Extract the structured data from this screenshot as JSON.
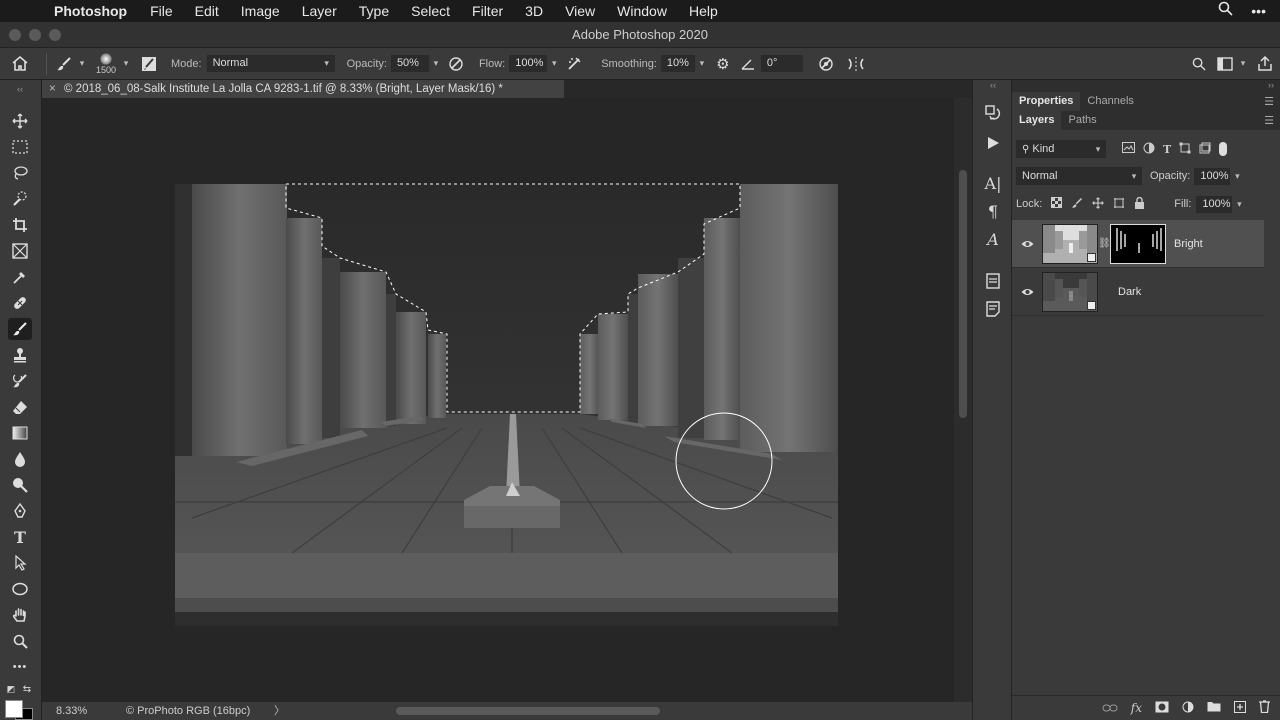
{
  "menubar": {
    "app_name": "Photoshop",
    "items": [
      "File",
      "Edit",
      "Image",
      "Layer",
      "Type",
      "Select",
      "Filter",
      "3D",
      "View",
      "Window",
      "Help"
    ],
    "right_icons": [
      "search-icon",
      "more-icon"
    ]
  },
  "titlebar": {
    "title": "Adobe Photoshop 2020"
  },
  "options": {
    "brush_size": "1500",
    "mode_label": "Mode:",
    "mode_value": "Normal",
    "opacity_label": "Opacity:",
    "opacity_value": "50%",
    "flow_label": "Flow:",
    "flow_value": "100%",
    "smoothing_label": "Smoothing:",
    "smoothing_value": "10%",
    "angle_value": "0°"
  },
  "document": {
    "tab_title": "© 2018_06_08-Salk Institute La Jolla CA 9283-1.tif @ 8.33% (Bright, Layer Mask/16) *",
    "close_label": "×"
  },
  "statusbar": {
    "zoom": "8.33%",
    "profile": "© ProPhoto RGB (16bpc)",
    "arrow": "〉"
  },
  "panels": {
    "top_tabs": [
      {
        "label": "Properties",
        "active": true
      },
      {
        "label": "Channels",
        "active": false
      }
    ],
    "layer_tabs": [
      {
        "label": "Layers",
        "active": true
      },
      {
        "label": "Paths",
        "active": false
      }
    ],
    "filter_kind": "Kind",
    "blend_mode": "Normal",
    "opacity_label": "Opacity:",
    "opacity_value": "100%",
    "lock_label": "Lock:",
    "fill_label": "Fill:",
    "fill_value": "100%",
    "layers": [
      {
        "name": "Bright",
        "selected": true,
        "visible": true,
        "has_mask": true
      },
      {
        "name": "Dark",
        "selected": false,
        "visible": true,
        "has_mask": false
      }
    ]
  },
  "colors": {
    "foreground": "#ffffff",
    "background": "#000000"
  }
}
